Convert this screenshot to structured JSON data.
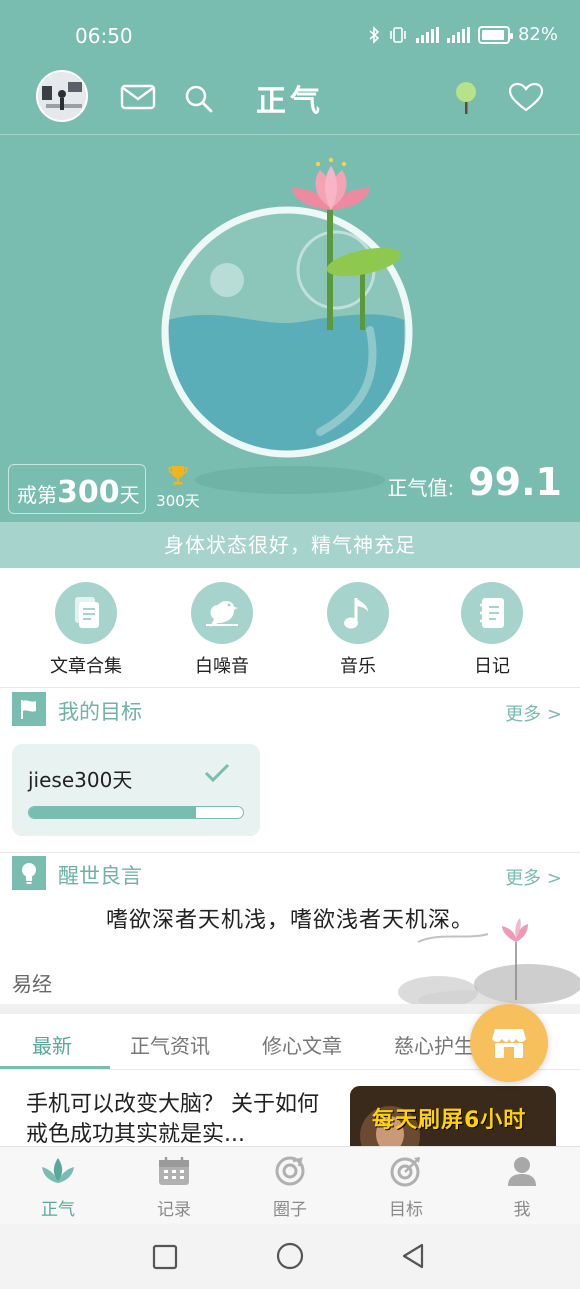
{
  "status_bar": {
    "time": "06:50",
    "battery": "82%"
  },
  "header": {
    "title": "正气"
  },
  "progress": {
    "prefix": "戒第",
    "days": "300",
    "suffix": "天",
    "badge_label": "300天",
    "value_label": "正气值:",
    "value": "99.1"
  },
  "state_text": "身体状态很好，精气神充足",
  "shortcuts": [
    {
      "label": "文章合集",
      "icon": "article-icon"
    },
    {
      "label": "白噪音",
      "icon": "bird-icon"
    },
    {
      "label": "音乐",
      "icon": "music-note-icon"
    },
    {
      "label": "日记",
      "icon": "diary-icon"
    }
  ],
  "goals": {
    "title": "我的目标",
    "more": "更多 >",
    "items": [
      {
        "name": "jiese300天",
        "progress": 0.78,
        "done": true
      }
    ]
  },
  "quote": {
    "title": "醒世良言",
    "more": "更多 >",
    "text": "嗜欲深者天机浅，嗜欲浅者天机深。",
    "source": "易经"
  },
  "tabs": [
    {
      "label": "最新",
      "active": true
    },
    {
      "label": "正气资讯",
      "active": false
    },
    {
      "label": "修心文章",
      "active": false
    },
    {
      "label": "慈心护生",
      "active": false
    }
  ],
  "article": {
    "title": "手机可以改变大脑？ 关于如何戒色成功其实就是实...",
    "thumb_text": "每天刷屏6小时"
  },
  "bottom_nav": [
    {
      "label": "正气",
      "icon": "lotus-icon",
      "active": true
    },
    {
      "label": "记录",
      "icon": "calendar-icon",
      "active": false
    },
    {
      "label": "圈子",
      "icon": "circle-icon",
      "active": false
    },
    {
      "label": "目标",
      "icon": "target-icon",
      "active": false
    },
    {
      "label": "我",
      "icon": "user-icon",
      "active": false
    }
  ],
  "colors": {
    "primary": "#79bcb0",
    "accent": "#f7c05c",
    "text": "#222222"
  }
}
